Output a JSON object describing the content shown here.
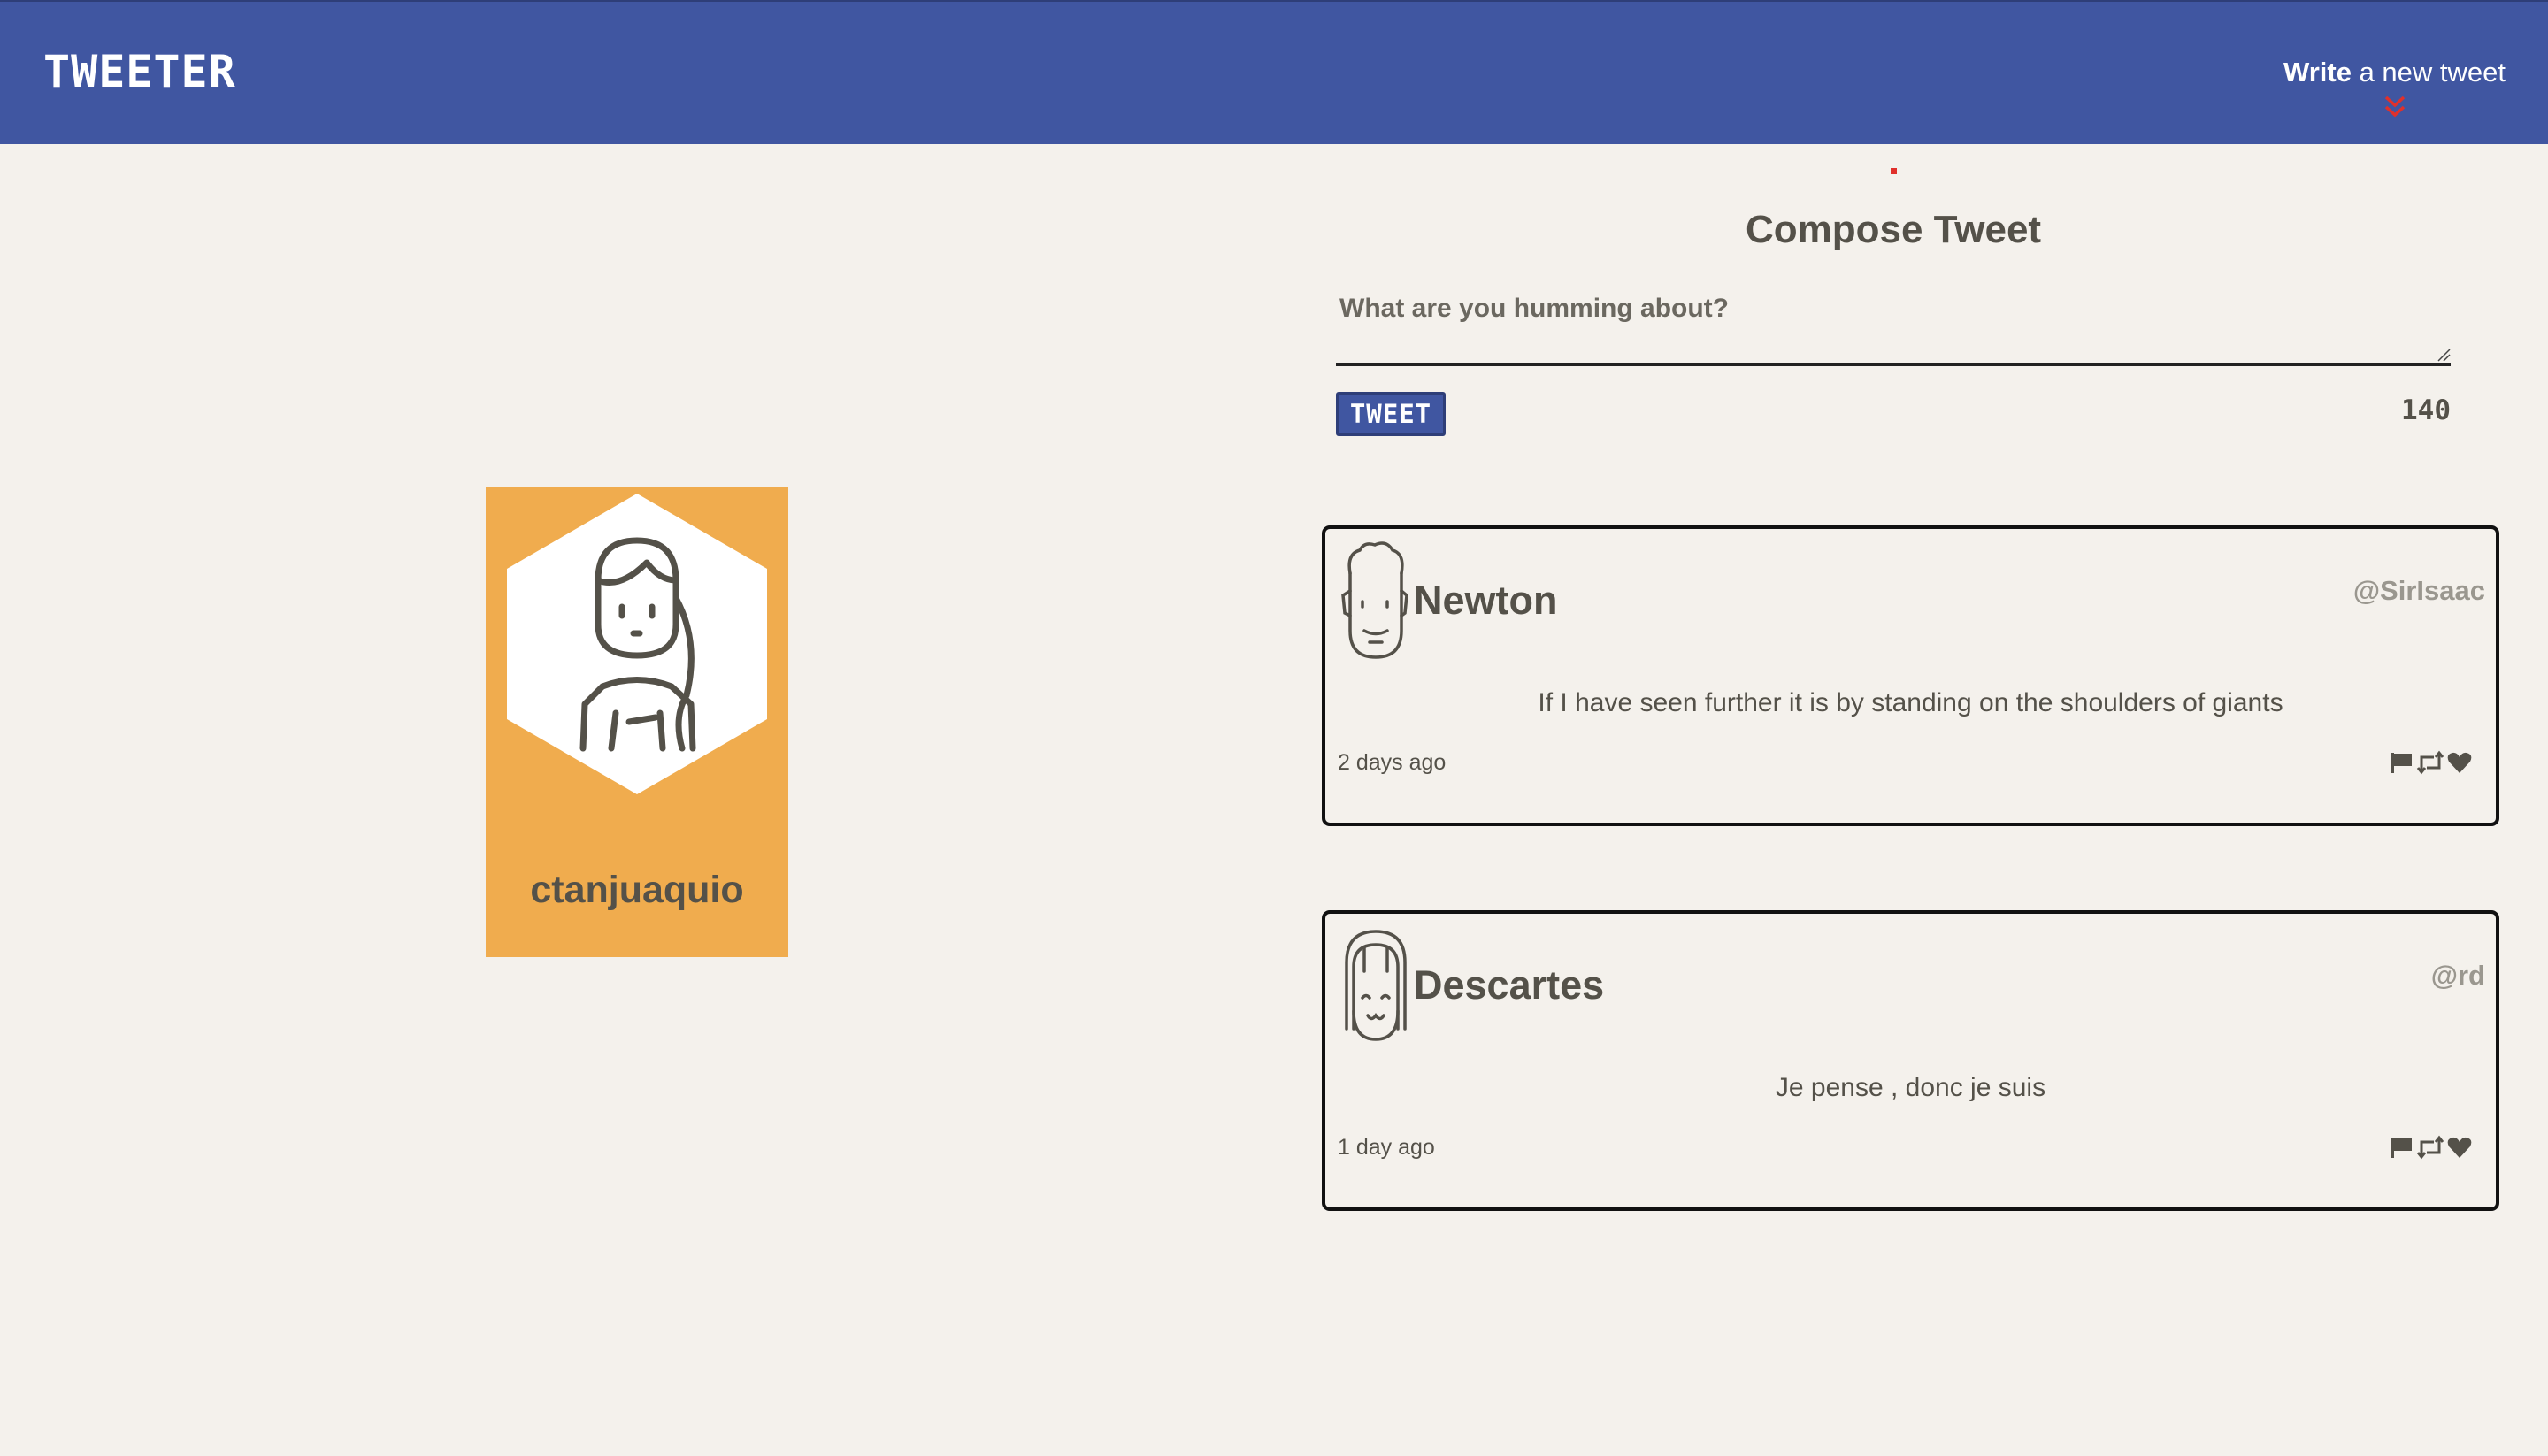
{
  "nav": {
    "brand": "TWEETER",
    "action_strong": "Write",
    "action_rest": " a new tweet",
    "chevron_icon": "double-chevron-down-icon",
    "chevron_color": "#e0302b"
  },
  "profile": {
    "handle": "ctanjuaquio",
    "card_color": "#f0ac4e"
  },
  "compose": {
    "title": "Compose Tweet",
    "placeholder": "What are you humming about?",
    "button_label": "TWEET",
    "counter": "140"
  },
  "tweets": [
    {
      "name": "Newton",
      "handle": "@SirIsaac",
      "text": "If I have seen further it is by standing on the shoulders of giants",
      "time": "2 days ago",
      "icons": [
        "flag-icon",
        "retweet-icon",
        "heart-icon"
      ]
    },
    {
      "name": "Descartes",
      "handle": "@rd",
      "text": "Je pense , donc je suis",
      "time": "1 day ago",
      "icons": [
        "flag-icon",
        "retweet-icon",
        "heart-icon"
      ]
    }
  ],
  "colors": {
    "nav": "#4056a1",
    "background": "#f4f1ec",
    "text": "#545149",
    "muted": "#9a978f"
  }
}
